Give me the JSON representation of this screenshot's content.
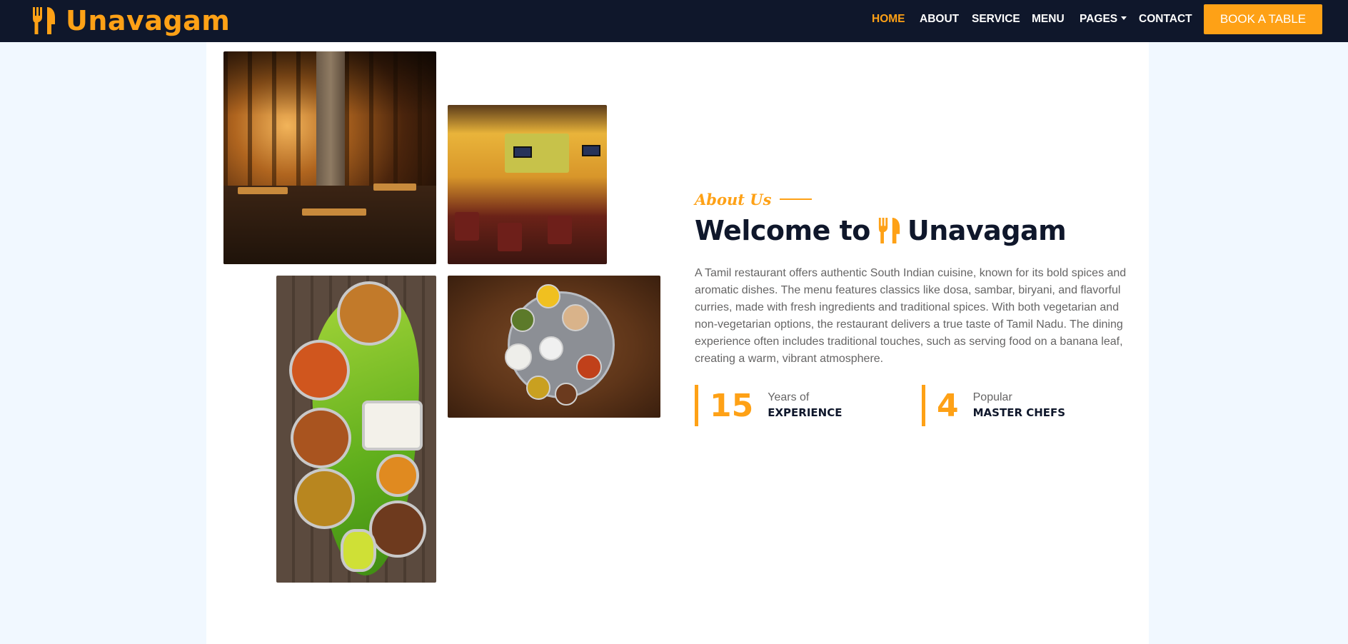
{
  "brand": {
    "name": "Unavagam",
    "icon": "utensils-icon",
    "color": "#fea116"
  },
  "nav": {
    "items": [
      {
        "label": "HOME",
        "active": true
      },
      {
        "label": "ABOUT"
      },
      {
        "label": "SERVICE"
      },
      {
        "label": "MENU"
      },
      {
        "label": "PAGES"
      },
      {
        "label": "CONTACT"
      }
    ],
    "cta": "BOOK A TABLE"
  },
  "about": {
    "subtitle": "About Us",
    "title_prefix": "Welcome to",
    "title_brand": "Unavagam",
    "description": "A Tamil restaurant offers authentic South Indian cuisine, known for its bold spices and aromatic dishes. The menu features classics like dosa, sambar, biryani, and flavorful curries, made with fresh ingredients and traditional spices. With both vegetarian and non-vegetarian options, the restaurant delivers a true taste of Tamil Nadu. The dining experience often includes traditional touches, such as serving food on a banana leaf, creating a warm, vibrant atmosphere.",
    "stats": [
      {
        "number": "15",
        "label_top": "Years of",
        "label_bottom": "EXPERIENCE"
      },
      {
        "number": "4",
        "label_top": "Popular",
        "label_bottom": "MASTER CHEFS"
      }
    ]
  },
  "colors": {
    "primary": "#fea116",
    "dark": "#0f172b",
    "page_bg": "#f1f8ff",
    "text": "#666565"
  }
}
